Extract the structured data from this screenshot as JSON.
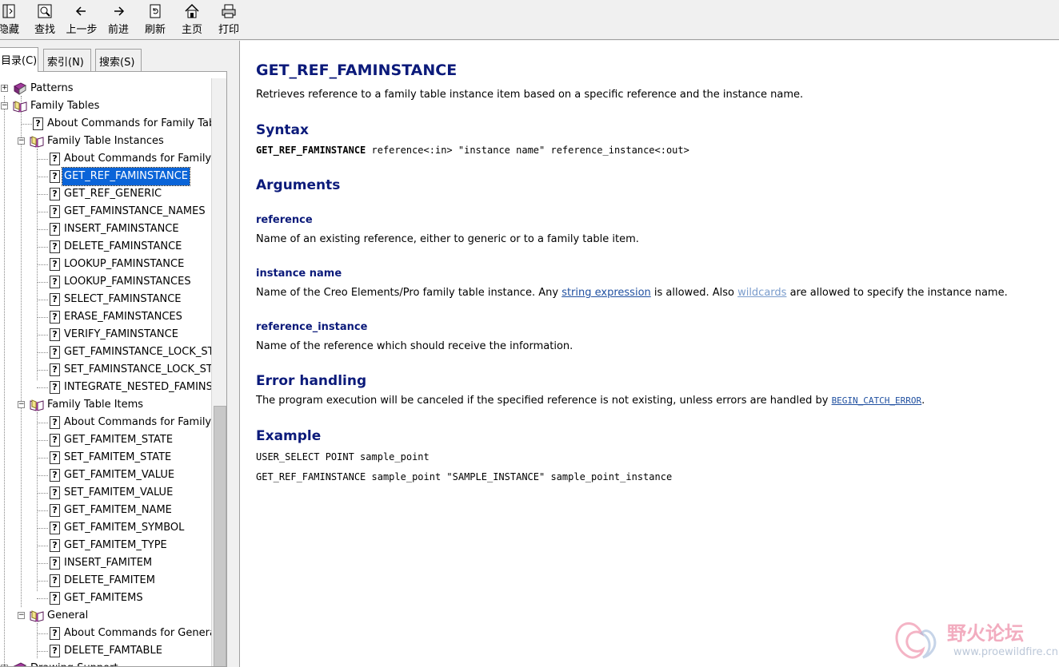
{
  "toolbar": {
    "hide": "隐藏",
    "find": "查找",
    "back": "上一步",
    "forward": "前进",
    "refresh": "刷新",
    "home": "主页",
    "print": "打印"
  },
  "tabs": {
    "contents": "目录(C)",
    "index": "索引(N)",
    "search": "搜索(S)"
  },
  "tree": {
    "patterns": "Patterns",
    "family_tables": "Family Tables",
    "ft_about": "About Commands for Family Tab",
    "fti": "Family Table Instances",
    "fti_items": [
      "About Commands for Family",
      "GET_REF_FAMINSTANCE",
      "GET_REF_GENERIC",
      "GET_FAMINSTANCE_NAMES",
      "INSERT_FAMINSTANCE",
      "DELETE_FAMINSTANCE",
      "LOOKUP_FAMINSTANCE",
      "LOOKUP_FAMINSTANCES",
      "SELECT_FAMINSTANCE",
      "ERASE_FAMINSTANCES",
      "VERIFY_FAMINSTANCE",
      "GET_FAMINSTANCE_LOCK_ST",
      "SET_FAMINSTANCE_LOCK_ST",
      "INTEGRATE_NESTED_FAMINS"
    ],
    "ftitems": "Family Table Items",
    "ftitems_items": [
      "About Commands for Family",
      "GET_FAMITEM_STATE",
      "SET_FAMITEM_STATE",
      "GET_FAMITEM_VALUE",
      "SET_FAMITEM_VALUE",
      "GET_FAMITEM_NAME",
      "GET_FAMITEM_SYMBOL",
      "GET_FAMITEM_TYPE",
      "INSERT_FAMITEM",
      "DELETE_FAMITEM",
      "GET_FAMITEMS"
    ],
    "general": "General",
    "general_items": [
      "About Commands for Genera",
      "DELETE_FAMTABLE"
    ],
    "drawing_support": "Drawing Support"
  },
  "content": {
    "title": "GET_REF_FAMINSTANCE",
    "intro": "Retrieves reference to a family table instance item based on a specific reference and the instance name.",
    "syntax_heading": "Syntax",
    "syntax_cmd": "GET_REF_FAMINSTANCE",
    "syntax_args": " reference<:in> \"instance name\" reference_instance<:out>",
    "arguments_heading": "Arguments",
    "arg1_name": "reference",
    "arg1_desc": "Name of an existing reference, either to generic or to a family table item.",
    "arg2_name": "instance name",
    "arg2_desc_a": "Name of the Creo Elements/Pro family table instance. Any ",
    "arg2_link1": "string expression",
    "arg2_desc_b": " is allowed. Also ",
    "arg2_link2": "wildcards",
    "arg2_desc_c": " are allowed to specify the instance name.",
    "arg3_name": "reference_instance",
    "arg3_desc": "Name of the reference which should receive the information.",
    "error_heading": "Error handling",
    "error_desc": "The program execution will be canceled if the specified reference is not existing, unless errors are handled by ",
    "error_link": "BEGIN_CATCH_ERROR",
    "error_end": ".",
    "example_heading": "Example",
    "example_line1": "USER_SELECT POINT sample_point",
    "example_line2": "GET_REF_FAMINSTANCE sample_point \"SAMPLE_INSTANCE\" sample_point_instance"
  },
  "watermark": {
    "title": "野火论坛",
    "url": "www.proewildfire.cn"
  }
}
